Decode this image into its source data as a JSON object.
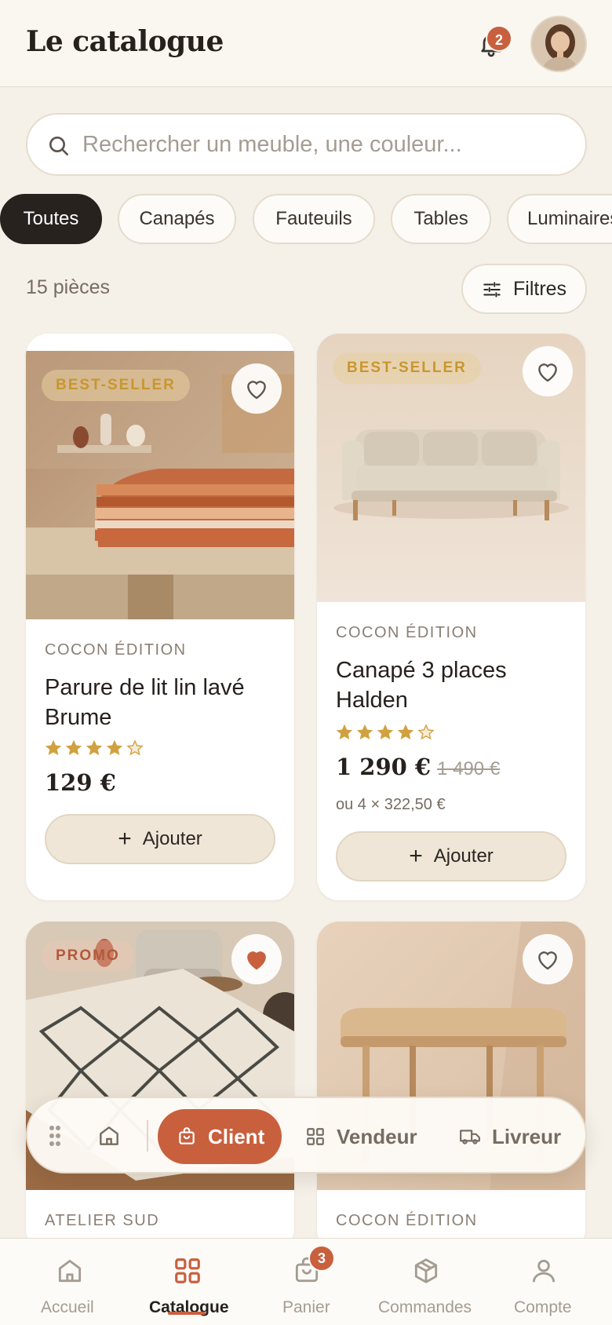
{
  "header": {
    "title": "Le catalogue",
    "notifications_count": "2"
  },
  "search": {
    "placeholder": "Rechercher un meuble, une couleur..."
  },
  "categories": [
    "Toutes",
    "Canapés",
    "Fauteuils",
    "Tables",
    "Luminaires"
  ],
  "results": {
    "count_label": "15 pièces",
    "filters_label": "Filtres"
  },
  "products": [
    {
      "tag": "BEST-SELLER",
      "brand": "COCON ÉDITION",
      "name": "Parure de lit lin lavé Brume",
      "rating": 4,
      "price": "129 €",
      "old_price": "",
      "installment": "",
      "favorite": false,
      "add_label": "Ajouter"
    },
    {
      "tag": "BEST-SELLER",
      "brand": "COCON ÉDITION",
      "name": "Canapé 3 places Halden",
      "rating": 4,
      "price": "1 290 €",
      "old_price": "1 490 €",
      "installment": "ou 4 × 322,50 €",
      "favorite": false,
      "add_label": "Ajouter"
    },
    {
      "tag": "PROMO",
      "brand": "ATELIER SUD",
      "favorite": true
    },
    {
      "tag": "",
      "brand": "COCON ÉDITION",
      "favorite": false
    }
  ],
  "role_switcher": {
    "client": "Client",
    "vendeur": "Vendeur",
    "livreur": "Livreur",
    "active": "client"
  },
  "bottom_nav": {
    "items": [
      "Accueil",
      "Catalogue",
      "Panier",
      "Commandes",
      "Compte"
    ],
    "active": "Catalogue",
    "cart_count": "3"
  },
  "colors": {
    "accent": "#c8603e",
    "gold": "#c9962e",
    "ink": "#26211d",
    "background": "#f5f0e8"
  }
}
